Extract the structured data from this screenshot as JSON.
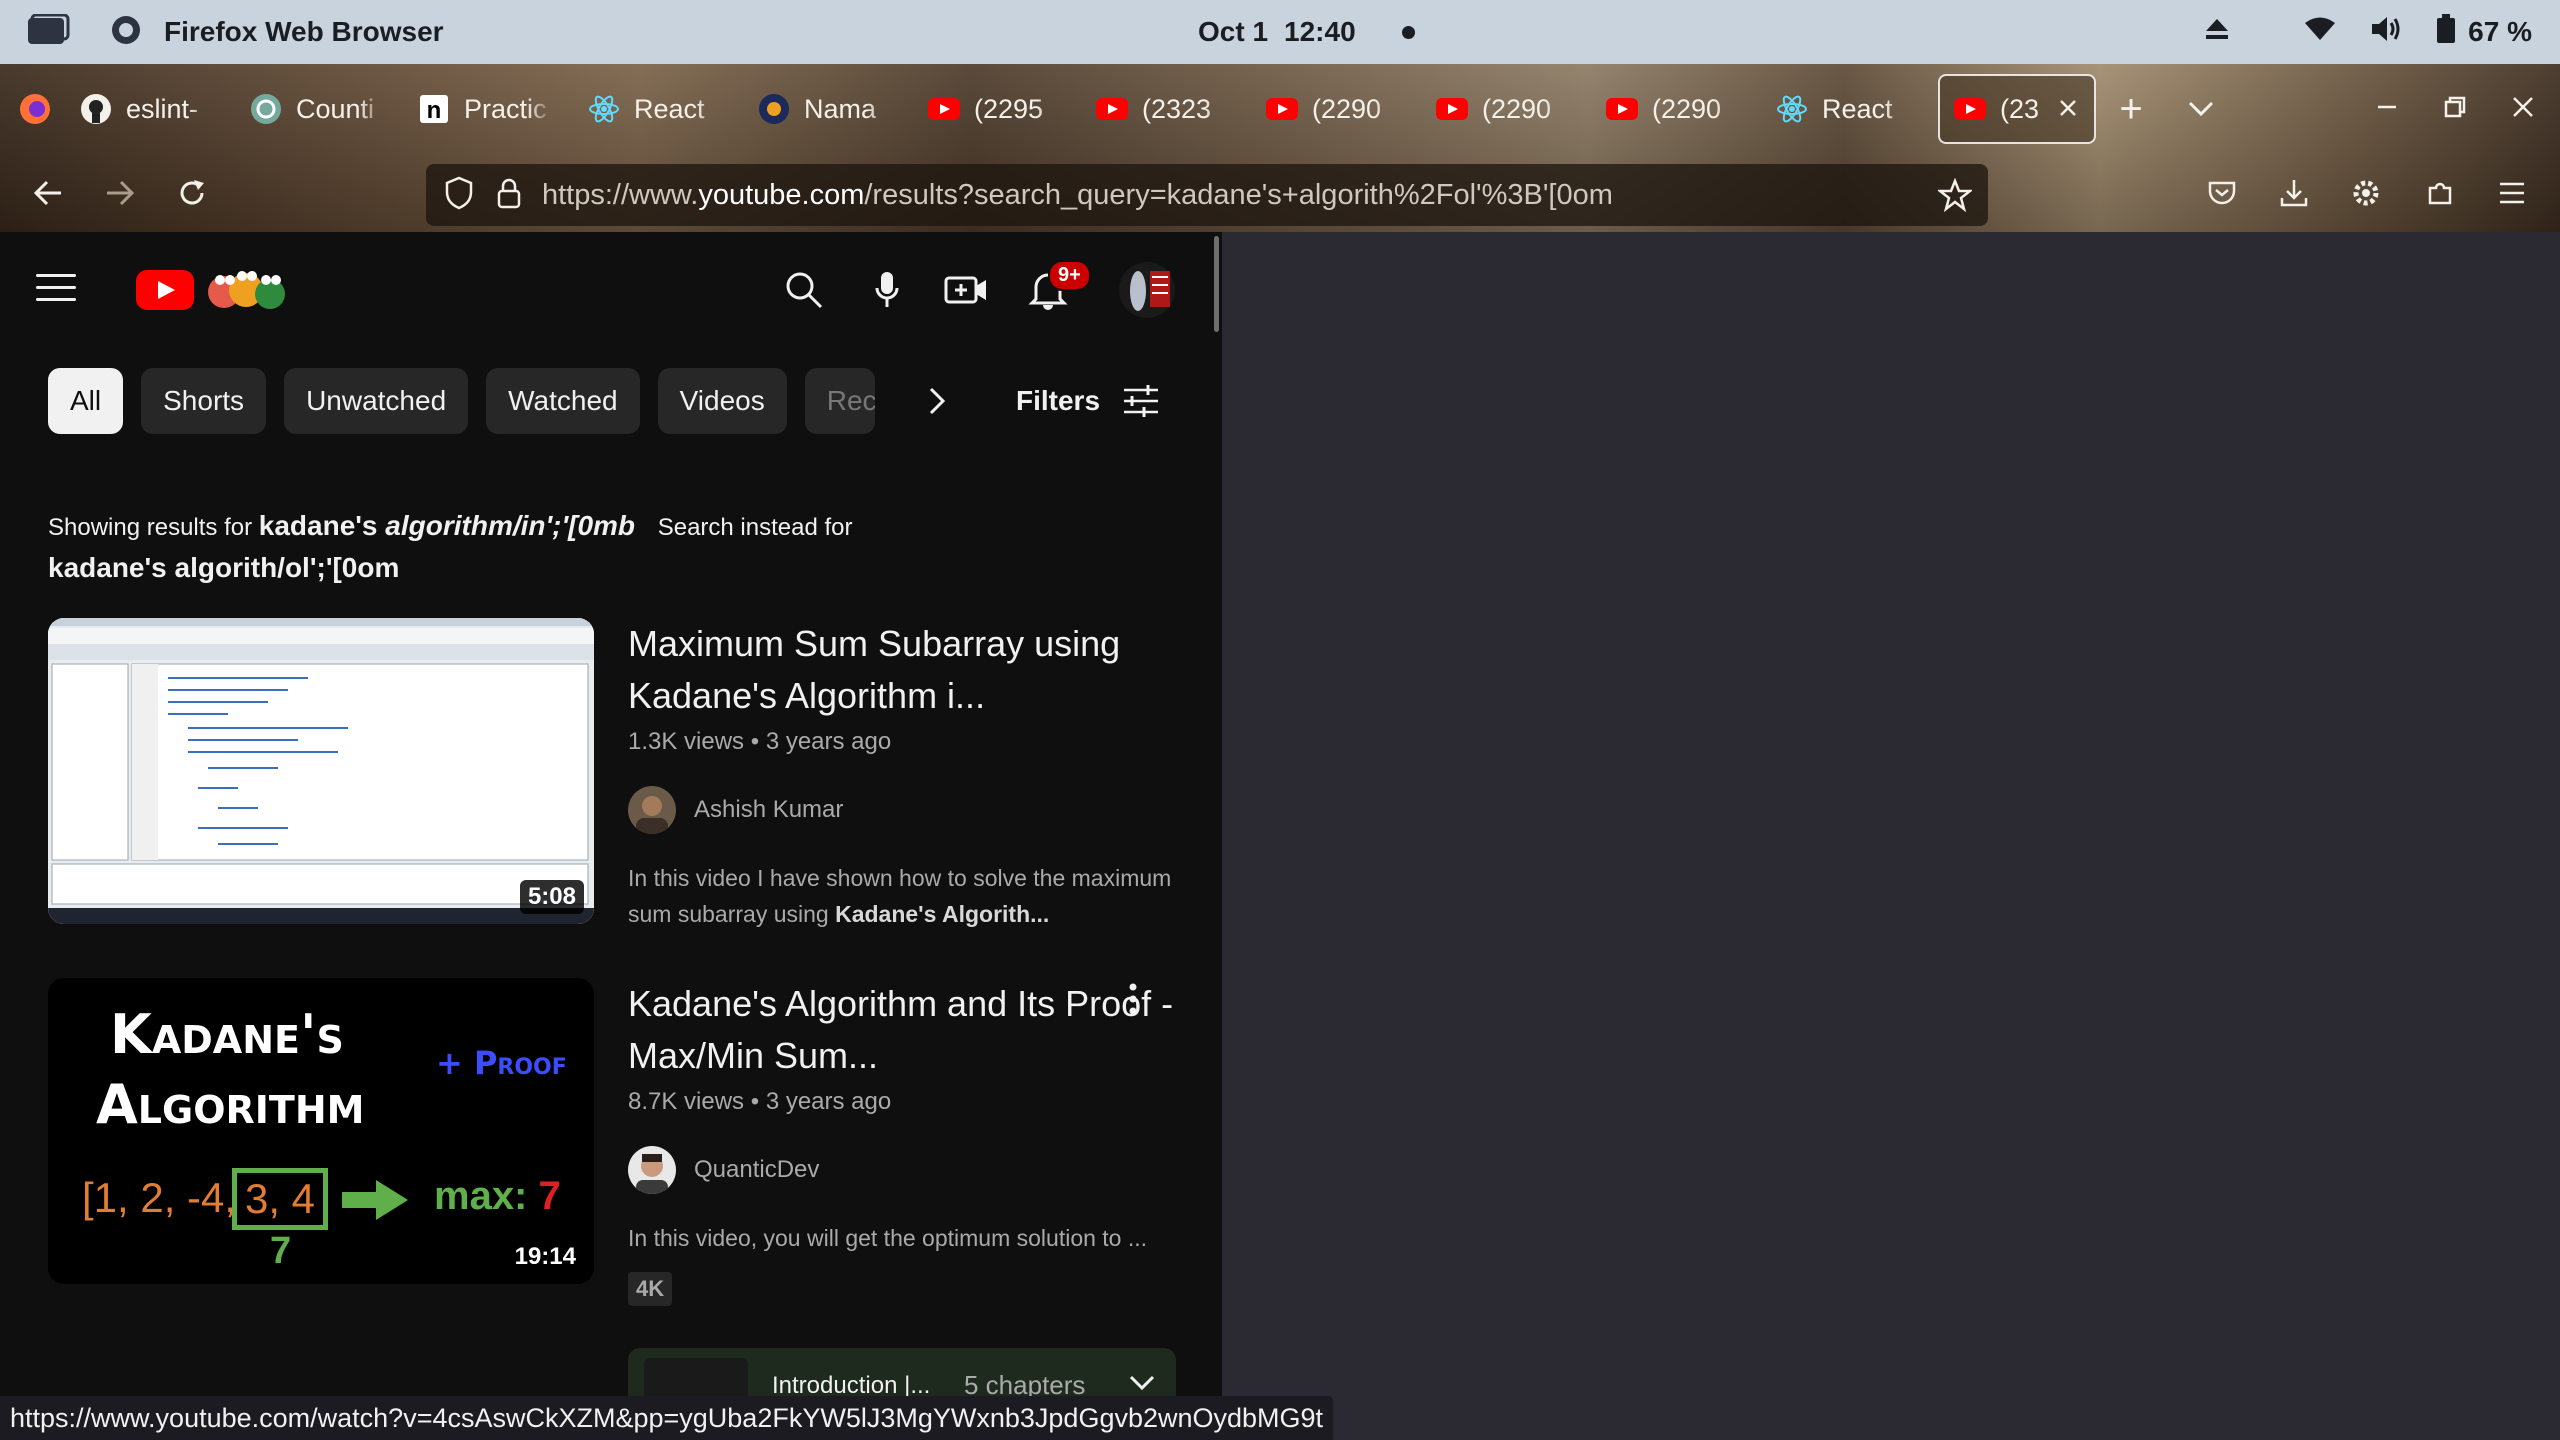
{
  "os_bar": {
    "app_title": "Firefox Web Browser",
    "date": "Oct 1",
    "time": "12:40",
    "battery": "67 %"
  },
  "tabs": [
    {
      "label": "eslint-",
      "icon": "github-icon"
    },
    {
      "label": "Counti",
      "icon": "chatgpt-icon"
    },
    {
      "label": "Practic",
      "icon": "notion-icon"
    },
    {
      "label": "React",
      "icon": "react-icon"
    },
    {
      "label": "Nama",
      "icon": "site-favicon"
    },
    {
      "label": "(2295",
      "icon": "youtube-icon"
    },
    {
      "label": "(2323",
      "icon": "youtube-icon"
    },
    {
      "label": "(2290",
      "icon": "youtube-icon"
    },
    {
      "label": "(2290",
      "icon": "youtube-icon"
    },
    {
      "label": "(2290",
      "icon": "youtube-icon"
    },
    {
      "label": "React",
      "icon": "react-icon"
    },
    {
      "label": "(23",
      "icon": "youtube-icon",
      "active": true
    }
  ],
  "url": {
    "prefix": "https://www.",
    "host": "youtube.com",
    "path": "/results?search_query=kadane's+algorith%2Fol'%3B'[0om"
  },
  "youtube": {
    "notification_count": "9+",
    "chips": [
      "All",
      "Shorts",
      "Unwatched",
      "Watched",
      "Videos",
      "Rec"
    ],
    "filters_label": "Filters",
    "showing_prefix": "Showing results for",
    "showing_query_plain": "kadane's",
    "showing_query_italic": "algorithm/in';'[0mb",
    "instead_label": "Search instead for",
    "instead_query": "kadane's algorith/ol';'[0om"
  },
  "results": [
    {
      "title": "Maximum Sum Subarray using Kadane's Algorithm i...",
      "views": "1.3K views",
      "age": "3 years ago",
      "channel": "Ashish Kumar",
      "desc_plain": "In this video I have shown how to solve the maximum sum subarray using ",
      "desc_bold": "Kadane's Algorith...",
      "duration": "5:08"
    },
    {
      "title": "Kadane's Algorithm and Its Proof - Max/Min Sum...",
      "views": "8.7K views",
      "age": "3 years ago",
      "channel": "QuanticDev",
      "desc_plain": "In this video, you will get the optimum solution to ...",
      "badge": "4K",
      "duration": "19:14",
      "thumb_title_1": "Kadane's",
      "thumb_title_2": "Algorithm",
      "thumb_proof": "+ Proof",
      "thumb_array": "[1, 2, -4,",
      "thumb_box": "3, 4",
      "thumb_max_label": "max:",
      "thumb_max_value": "7",
      "thumb_sum": "7"
    }
  ],
  "chapters": {
    "title": "Introduction |...",
    "count": "5 chapters"
  },
  "status_url": "https://www.youtube.com/watch?v=4csAswCkXZM&pp=ygUba2FkYW5lJ3MgYWxnb3JpdGgvb2wnOydbMG9t",
  "colors": {
    "youtube_red": "#ff0000",
    "page_bg": "#0f0f0f",
    "chip_bg": "#272727"
  }
}
